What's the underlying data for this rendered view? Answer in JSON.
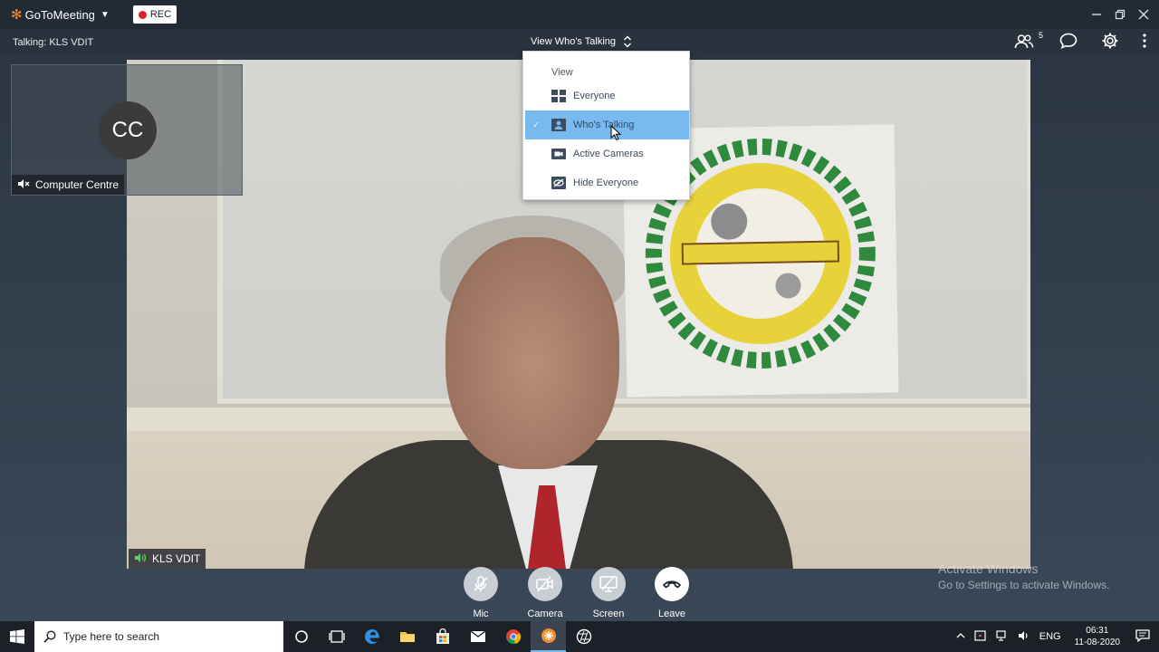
{
  "app": {
    "brand": "GoToMeeting",
    "rec_label": "REC"
  },
  "header": {
    "talking": "Talking: KLS VDIT",
    "view_selector": "View Who's Talking",
    "attendee_count": "5"
  },
  "view_menu": {
    "header": "View",
    "items": [
      {
        "label": "Everyone",
        "icon": "grid-icon",
        "selected": false
      },
      {
        "label": "Who's Talking",
        "icon": "person-icon",
        "selected": true
      },
      {
        "label": "Active Cameras",
        "icon": "camera-icon",
        "selected": false
      },
      {
        "label": "Hide Everyone",
        "icon": "hide-eye-icon",
        "selected": false
      }
    ]
  },
  "self_view": {
    "initials": "CC",
    "name": "Computer Centre"
  },
  "speaker": {
    "name": "KLS VDIT"
  },
  "controls": {
    "mic": "Mic",
    "camera": "Camera",
    "screen": "Screen",
    "leave": "Leave"
  },
  "watermark": {
    "line1": "Activate Windows",
    "line2": "Go to Settings to activate Windows."
  },
  "taskbar": {
    "search_placeholder": "Type here to search",
    "language": "ENG",
    "time": "06:31",
    "date": "11-08-2020"
  },
  "colors": {
    "accent_orange": "#f68d2e",
    "selection_blue": "#78baf0",
    "rec_red": "#e0202a",
    "speaking_green": "#5fd069"
  }
}
